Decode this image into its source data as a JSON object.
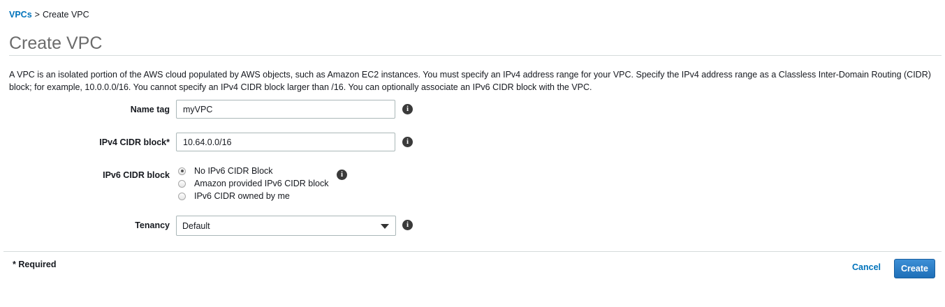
{
  "breadcrumb": {
    "parent": "VPCs",
    "separator": ">",
    "current": "Create VPC"
  },
  "page": {
    "title": "Create VPC",
    "description": "A VPC is an isolated portion of the AWS cloud populated by AWS objects, such as Amazon EC2 instances. You must specify an IPv4 address range for your VPC. Specify the IPv4 address range as a Classless Inter-Domain Routing (CIDR) block; for example, 10.0.0.0/16. You cannot specify an IPv4 CIDR block larger than /16. You can optionally associate an IPv6 CIDR block with the VPC."
  },
  "form": {
    "name_tag": {
      "label": "Name tag",
      "value": "myVPC"
    },
    "ipv4_cidr": {
      "label": "IPv4 CIDR block*",
      "value": "10.64.0.0/16"
    },
    "ipv6_cidr": {
      "label": "IPv6 CIDR block",
      "options": [
        {
          "label": "No IPv6 CIDR Block",
          "selected": true
        },
        {
          "label": "Amazon provided IPv6 CIDR block",
          "selected": false
        },
        {
          "label": "IPv6 CIDR owned by me",
          "selected": false
        }
      ]
    },
    "tenancy": {
      "label": "Tenancy",
      "value": "Default"
    },
    "info_glyph": "i"
  },
  "footer": {
    "required_note": "* Required",
    "cancel_label": "Cancel",
    "create_label": "Create"
  },
  "colors": {
    "link": "#0073bb",
    "primary_button": "#2a7fc9",
    "title": "#6b6b6b"
  },
  "icons": {
    "info": "info-circle-icon",
    "dropdown": "caret-down-icon"
  }
}
